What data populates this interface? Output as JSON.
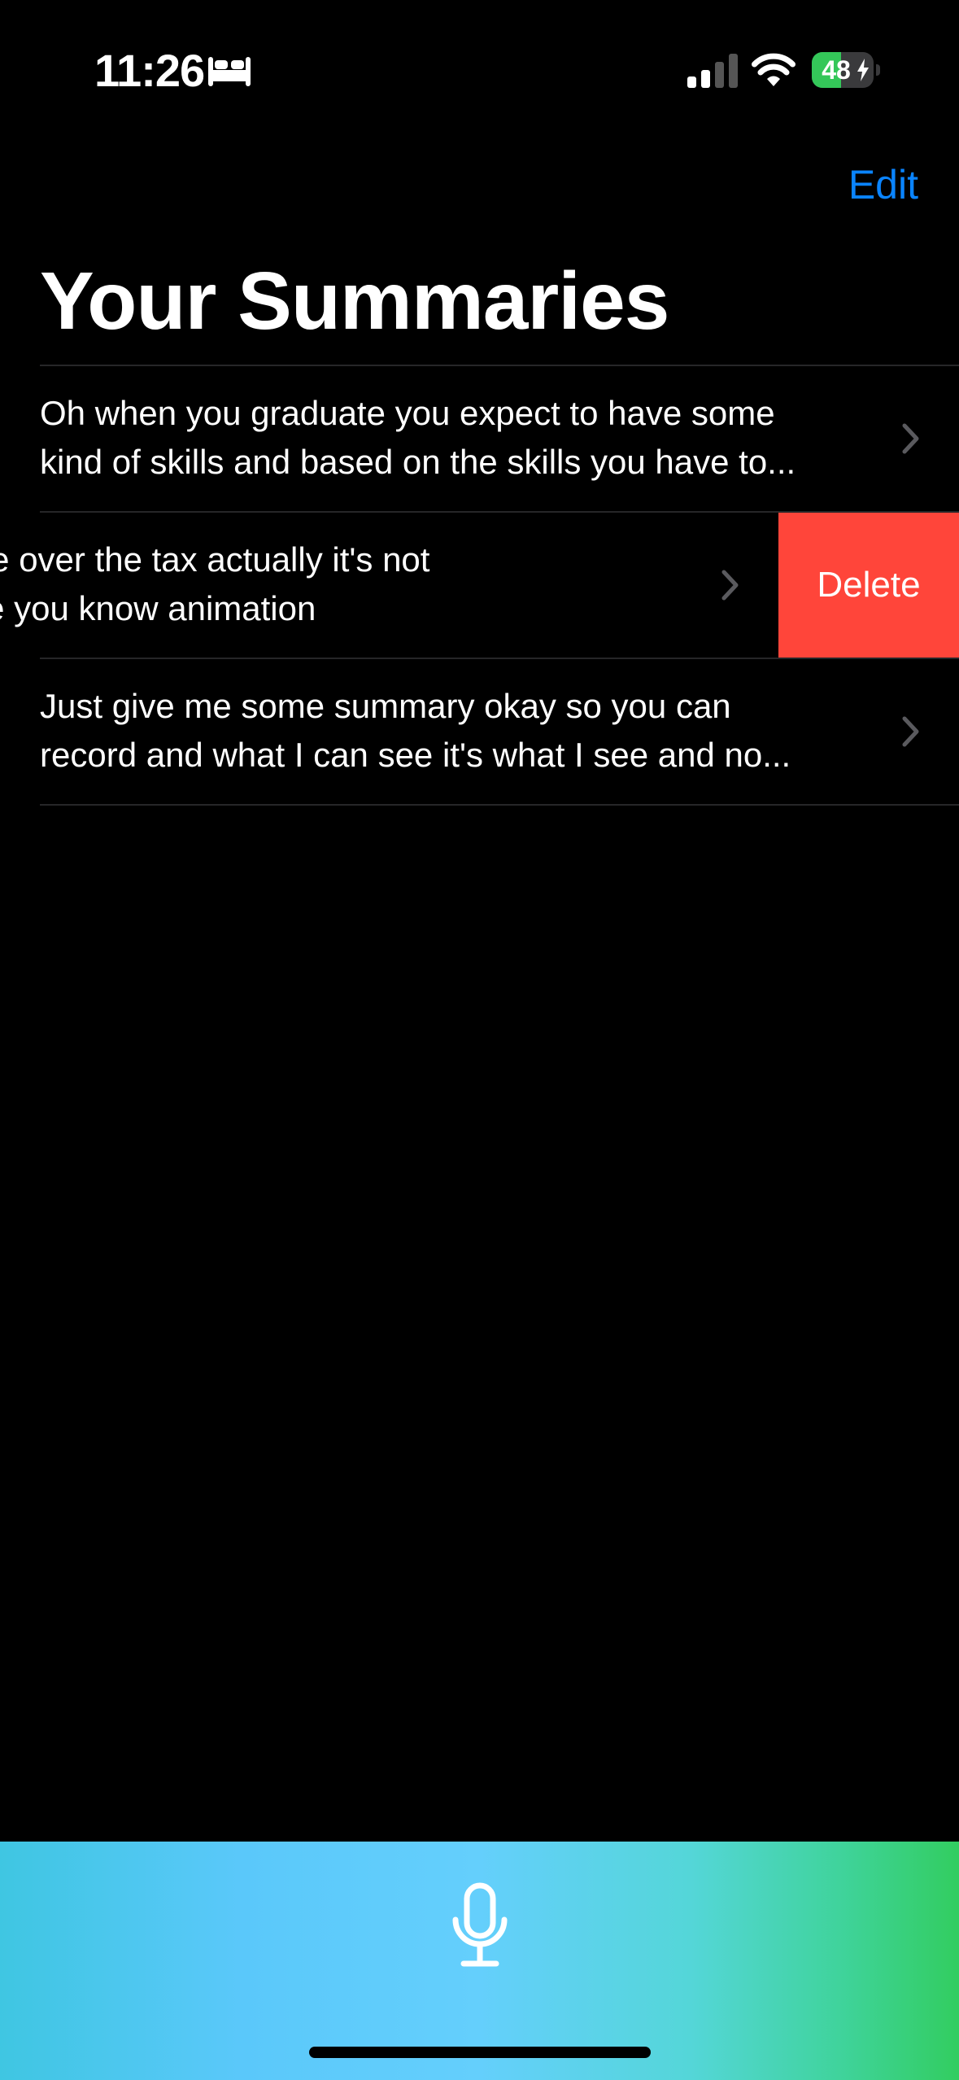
{
  "status_bar": {
    "time": "11:26",
    "focus_icon": "bed-icon",
    "battery_percent": "48",
    "battery_level": 0.48,
    "charging": true
  },
  "nav": {
    "edit_label": "Edit",
    "title": "Your Summaries"
  },
  "summaries": [
    {
      "line1": "Oh when you graduate you expect to have some",
      "line2": "kind of skills and based on the skills you have to..."
    },
    {
      "line1": "an elaborate over the tax actually it's not",
      "line2": "e it's nu rate you know animation",
      "swiped": true,
      "action_label": "Delete"
    },
    {
      "line1": "Just give me some summary okay so you can",
      "line2": "record and what I can see it's what I see and no..."
    }
  ],
  "colors": {
    "accent": "#0a84ff",
    "delete": "#ff453a",
    "battery_fill": "#34c759"
  },
  "record_bar": {
    "icon": "microphone-icon"
  }
}
